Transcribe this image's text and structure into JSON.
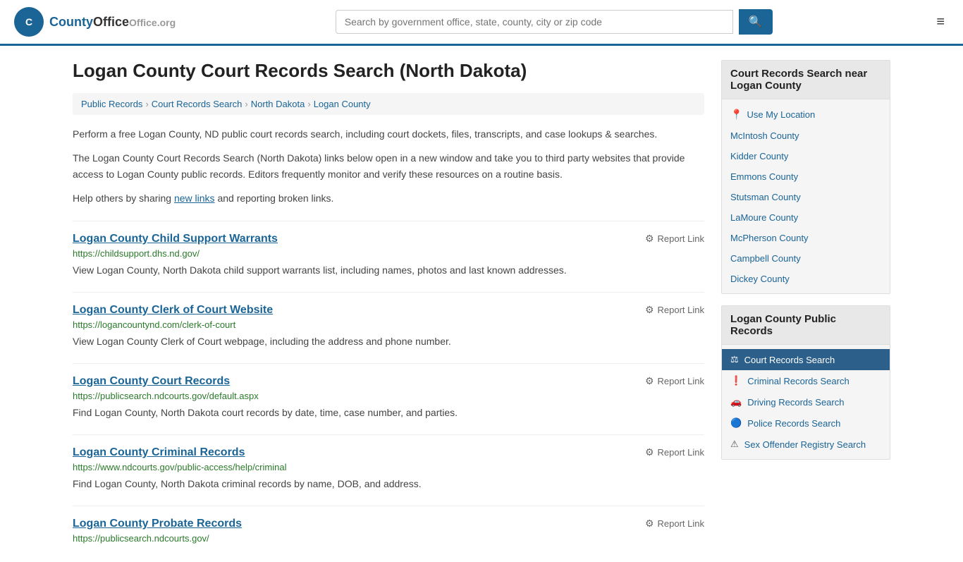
{
  "header": {
    "logo_text": "County",
    "logo_org": "Office.org",
    "search_placeholder": "Search by government office, state, county, city or zip code"
  },
  "page": {
    "title": "Logan County Court Records Search (North Dakota)"
  },
  "breadcrumb": {
    "items": [
      {
        "label": "Public Records",
        "href": "#"
      },
      {
        "label": "Court Records Search",
        "href": "#"
      },
      {
        "label": "North Dakota",
        "href": "#"
      },
      {
        "label": "Logan County",
        "href": "#"
      }
    ]
  },
  "descriptions": [
    "Perform a free Logan County, ND public court records search, including court dockets, files, transcripts, and case lookups & searches.",
    "The Logan County Court Records Search (North Dakota) links below open in a new window and take you to third party websites that provide access to Logan County public records. Editors frequently monitor and verify these resources on a routine basis.",
    "Help others by sharing new links and reporting broken links."
  ],
  "new_links_text": "new links",
  "records": [
    {
      "title": "Logan County Child Support Warrants",
      "url": "https://childsupport.dhs.nd.gov/",
      "description": "View Logan County, North Dakota child support warrants list, including names, photos and last known addresses.",
      "report_label": "Report Link"
    },
    {
      "title": "Logan County Clerk of Court Website",
      "url": "https://logancountynd.com/clerk-of-court",
      "description": "View Logan County Clerk of Court webpage, including the address and phone number.",
      "report_label": "Report Link"
    },
    {
      "title": "Logan County Court Records",
      "url": "https://publicsearch.ndcourts.gov/default.aspx",
      "description": "Find Logan County, North Dakota court records by date, time, case number, and parties.",
      "report_label": "Report Link"
    },
    {
      "title": "Logan County Criminal Records",
      "url": "https://www.ndcourts.gov/public-access/help/criminal",
      "description": "Find Logan County, North Dakota criminal records by name, DOB, and address.",
      "report_label": "Report Link"
    },
    {
      "title": "Logan County Probate Records",
      "url": "https://publicsearch.ndcourts.gov/",
      "description": "",
      "report_label": "Report Link"
    }
  ],
  "sidebar": {
    "nearby_section": {
      "header": "Court Records Search near Logan County",
      "use_location": "Use My Location",
      "counties": [
        "McIntosh County",
        "Kidder County",
        "Emmons County",
        "Stutsman County",
        "LaMoure County",
        "McPherson County",
        "Campbell County",
        "Dickey County"
      ]
    },
    "public_records_section": {
      "header": "Logan County Public Records",
      "items": [
        {
          "label": "Court Records Search",
          "active": true,
          "icon": "⚖"
        },
        {
          "label": "Criminal Records Search",
          "active": false,
          "icon": "❗"
        },
        {
          "label": "Driving Records Search",
          "active": false,
          "icon": "🚗"
        },
        {
          "label": "Police Records Search",
          "active": false,
          "icon": "🔵"
        },
        {
          "label": "Sex Offender Registry Search",
          "active": false,
          "icon": "⚠"
        }
      ]
    }
  }
}
